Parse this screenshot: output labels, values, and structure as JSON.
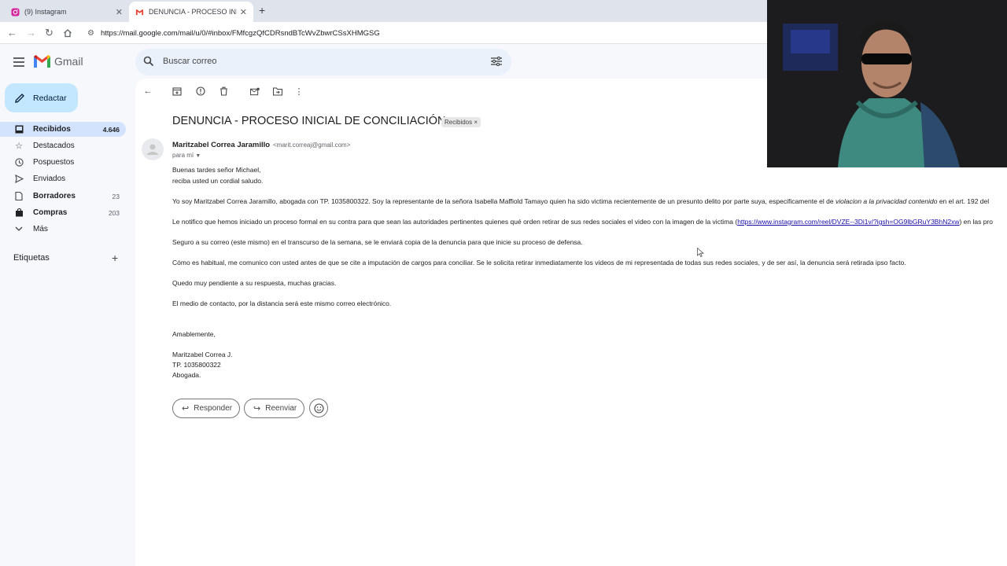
{
  "browser": {
    "tabs": [
      {
        "label": "(9) Instagram",
        "active": false
      },
      {
        "label": "DENUNCIA - PROCESO INICIAL",
        "active": true
      }
    ],
    "url": "https://mail.google.com/mail/u/0/#inbox/FMfcgzQfCDRsndBTcWvZbwrCSsXHMGSG"
  },
  "gmail": {
    "brand": "Gmail",
    "search_placeholder": "Buscar correo",
    "compose_label": "Redactar",
    "nav": [
      {
        "label": "Recibidos",
        "count": "4.646",
        "icon": "inbox-icon"
      },
      {
        "label": "Destacados",
        "count": "",
        "icon": "star-icon"
      },
      {
        "label": "Pospuestos",
        "count": "",
        "icon": "clock-icon"
      },
      {
        "label": "Enviados",
        "count": "",
        "icon": "send-icon"
      },
      {
        "label": "Borradores",
        "count": "23",
        "icon": "draft-icon"
      },
      {
        "label": "Compras",
        "count": "203",
        "icon": "shopping-icon"
      },
      {
        "label": "Más",
        "count": "",
        "icon": "chevron-down-icon"
      }
    ],
    "labels_heading": "Etiquetas"
  },
  "email": {
    "subject": "DENUNCIA - PROCESO INICIAL DE CONCILIACIÓN",
    "label_chip": "Recibidos ×",
    "sender_name": "Maritzabel Correa Jaramillo",
    "sender_email": "<marit.correaj@gmail.com>",
    "to": "para mí",
    "greeting1": "Buenas tardes señor Michael,",
    "greeting2": "reciba usted un cordial saludo.",
    "p1_a": "Yo soy Maritzabel Correa Jaramillo, abogada con TP. 1035800322. Soy la representante de la señora Isabella Maffiold Tamayo quien ha sido victima recientemente de un presunto delito por parte suya, especificamente el de ",
    "p1_italic": "violacion a la privacidad contenido",
    "p1_b": " en el art. 192 del",
    "p2_a": "Le notifico que hemos iniciado un proceso formal en su contra para que sean las autoridades pertinentes quienes qué orden retirar de sus redes sociales el video con la imagen de la victima (",
    "p2_link": "https://www.instagram.com/reel/DVZE--3Di1v/?igsh=OG9lbGRuY3BhN2xw",
    "p2_b": ") en las pro",
    "p3": "Seguro a su correo (este mismo) en el transcurso de la semana, se le enviará copia de la denuncia para que inicie su proceso de defensa.",
    "p4": "Cómo es habitual, me comunico con usted antes de que se cite a imputación de cargos para conciliar. Se le solicita retirar inmediatamente los videos de mi representada de todas sus redes sociales, y de ser así, la denuncia será retirada ipso facto.",
    "p5": "Quedo muy pendiente a su respuesta, muchas gracias.",
    "p6": "El medio de contacto, por la distancia será este mismo correo electrónico.",
    "closing": "Amablemente,",
    "sig1": "Maritzabel Correa J.",
    "sig2": "TP. 1035800322",
    "sig3": "Abogada.",
    "reply_label": "Responder",
    "forward_label": "Reenviar"
  },
  "colors": {
    "accent": "#c2e7ff",
    "selected_nav": "#d3e3fd",
    "link": "#1a0dab"
  }
}
